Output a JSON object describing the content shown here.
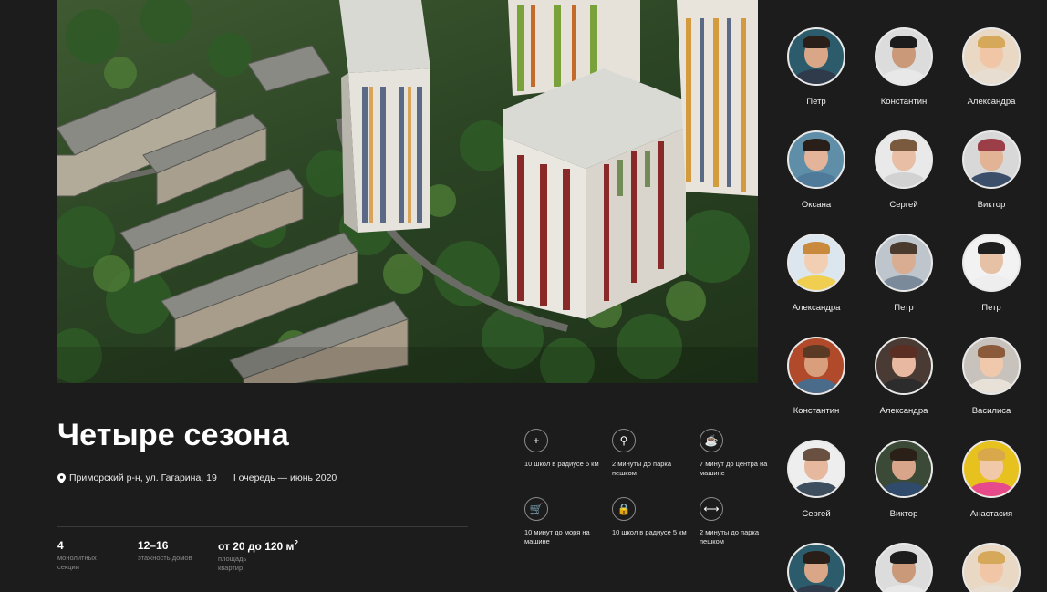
{
  "project": {
    "title": "Четыре сезона",
    "address": "Приморский р-н, ул. Гагарина, 19",
    "queue": "I очередь — июнь 2020"
  },
  "stats": [
    {
      "value": "4",
      "label": "монолитных секции"
    },
    {
      "value": "12–16",
      "label": "этажность домов"
    },
    {
      "value": "от 20 до 120 м",
      "sup": "2",
      "label": "площадь квартир"
    }
  ],
  "features": [
    {
      "icon": "plus-icon",
      "glyph": "+",
      "text": "10 школ в радиусе 5 км"
    },
    {
      "icon": "lamp-icon",
      "glyph": "⚲",
      "text": "2 минуты до парка пешком"
    },
    {
      "icon": "cup-icon",
      "glyph": "☕",
      "text": "7 минут до центра на машине"
    },
    {
      "icon": "cart-icon",
      "glyph": "🛒",
      "text": "10 минут до моря на машине"
    },
    {
      "icon": "bag-icon",
      "glyph": "🔒",
      "text": "10 школ в радиусе 5 км"
    },
    {
      "icon": "dumbbell-icon",
      "glyph": "⟷",
      "text": "2 минуты до парка пешком"
    }
  ],
  "people": [
    {
      "name": "Петр",
      "skin": "#d9a788",
      "hair": "#2a1f18",
      "shirt": "#2f3a4a",
      "bg": "#2c5c6c"
    },
    {
      "name": "Константин",
      "skin": "#c9997a",
      "hair": "#1c1c1c",
      "shirt": "#e8e8e8",
      "bg": "#dcdcdc"
    },
    {
      "name": "Александра",
      "skin": "#f0c6a6",
      "hair": "#d6a85a",
      "shirt": "#e7ddd0",
      "bg": "#e8d8c4"
    },
    {
      "name": "Оксана",
      "skin": "#e3b49a",
      "hair": "#2a1e19",
      "shirt": "#4f7a9a",
      "bg": "#5f8fa8"
    },
    {
      "name": "Сергей",
      "skin": "#e8bfa5",
      "hair": "#7a5a3e",
      "shirt": "#d2d2d2",
      "bg": "#e9e9e9"
    },
    {
      "name": "Виктор",
      "skin": "#e2b394",
      "hair": "#9b3e48",
      "shirt": "#3c4f6a",
      "bg": "#d8d8d8"
    },
    {
      "name": "Александра",
      "skin": "#f2cfb3",
      "hair": "#c98a3e",
      "shirt": "#f0cf50",
      "bg": "#dbe6ee"
    },
    {
      "name": "Петр",
      "skin": "#d9ad92",
      "hair": "#4a3a2e",
      "shirt": "#7a8a9a",
      "bg": "#bfc5cc"
    },
    {
      "name": "Петр",
      "skin": "#e7c1a5",
      "hair": "#1f1f1f",
      "shirt": "#eeeeee",
      "bg": "#f2f2f2"
    },
    {
      "name": "Константин",
      "skin": "#d99e7c",
      "hair": "#5a3a24",
      "shirt": "#4a6b8a",
      "bg": "#b04a2a"
    },
    {
      "name": "Александра",
      "skin": "#e8b9a0",
      "hair": "#5a2e22",
      "shirt": "#2c2c2c",
      "bg": "#4a3a34"
    },
    {
      "name": "Василиса",
      "skin": "#f0c9ad",
      "hair": "#8a5a3a",
      "shirt": "#e8e1d8",
      "bg": "#c8c2bc"
    },
    {
      "name": "Сергей",
      "skin": "#e6b99e",
      "hair": "#6a5040",
      "shirt": "#3e4e5e",
      "bg": "#eeeeee"
    },
    {
      "name": "Виктор",
      "skin": "#d9a58a",
      "hair": "#2a2018",
      "shirt": "#2f4a6a",
      "bg": "#3a4a36"
    },
    {
      "name": "Анастасия",
      "skin": "#f1c9a8",
      "hair": "#d8a84a",
      "shirt": "#e74a8a",
      "bg": "#e7c21e"
    },
    {
      "name": "",
      "skin": "#d9a788",
      "hair": "#2a1f18",
      "shirt": "#2f3a4a",
      "bg": "#2c5c6c"
    },
    {
      "name": "",
      "skin": "#c9997a",
      "hair": "#1c1c1c",
      "shirt": "#e8e8e8",
      "bg": "#dcdcdc"
    },
    {
      "name": "",
      "skin": "#f0c6a6",
      "hair": "#d6a85a",
      "shirt": "#e7ddd0",
      "bg": "#e8d8c4"
    }
  ]
}
